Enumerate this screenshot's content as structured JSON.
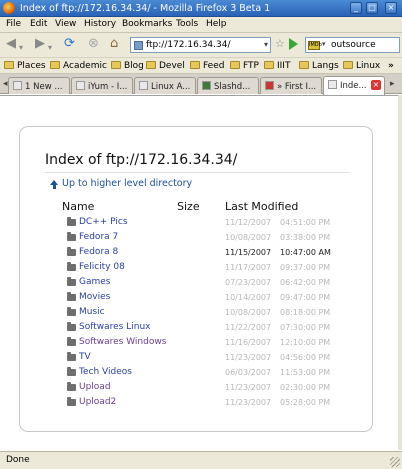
{
  "window": {
    "title": "Index of ftp://172.16.34.34/ - Mozilla Firefox 3 Beta 1"
  },
  "menu": [
    "File",
    "Edit",
    "View",
    "History",
    "Bookmarks",
    "Tools",
    "Help"
  ],
  "nav": {
    "url": "ftp://172.16.34.34/",
    "search_text": "outsource"
  },
  "bookmarks": [
    "Places",
    "Academic",
    "Blog",
    "Devel",
    "Feed",
    "FTP",
    "IIIT",
    "Langs",
    "Linux",
    "»"
  ],
  "tabs": [
    {
      "label": "1 New ...",
      "active": false
    },
    {
      "label": "iYum - I...",
      "active": false
    },
    {
      "label": "Linux A...",
      "active": false
    },
    {
      "label": "Slashd...",
      "active": false
    },
    {
      "label": "» First I...",
      "active": false
    },
    {
      "label": "Inde...",
      "active": true
    }
  ],
  "page": {
    "heading": "Index of ftp://172.16.34.34/",
    "up_link": "Up to higher level directory",
    "columns": {
      "name": "Name",
      "size": "Size",
      "modified": "Last Modified"
    },
    "entries": [
      {
        "name": "DC++ Pics",
        "date": "11/12/2007",
        "time": "04:51:00 PM",
        "visited": false,
        "highlight": false
      },
      {
        "name": "Fedora 7",
        "date": "10/08/2007",
        "time": "03:38:00 PM",
        "visited": false,
        "highlight": false
      },
      {
        "name": "Fedora 8",
        "date": "11/15/2007",
        "time": "10:47:00 AM",
        "visited": false,
        "highlight": true
      },
      {
        "name": "Felicity 08",
        "date": "11/17/2007",
        "time": "09:37:00 PM",
        "visited": false,
        "highlight": false
      },
      {
        "name": "Games",
        "date": "07/23/2007",
        "time": "06:42:00 PM",
        "visited": false,
        "highlight": false
      },
      {
        "name": "Movies",
        "date": "10/14/2007",
        "time": "09:47:00 PM",
        "visited": false,
        "highlight": false
      },
      {
        "name": "Music",
        "date": "10/08/2007",
        "time": "08:18:00 PM",
        "visited": false,
        "highlight": false
      },
      {
        "name": "Softwares Linux",
        "date": "11/22/2007",
        "time": "07:30:00 PM",
        "visited": false,
        "highlight": false
      },
      {
        "name": "Softwares Windows",
        "date": "11/16/2007",
        "time": "12:10:00 PM",
        "visited": true,
        "highlight": false
      },
      {
        "name": "TV",
        "date": "11/23/2007",
        "time": "04:56:00 PM",
        "visited": false,
        "highlight": false
      },
      {
        "name": "Tech Videos",
        "date": "06/03/2007",
        "time": "11:53:00 PM",
        "visited": false,
        "highlight": false
      },
      {
        "name": "Upload",
        "date": "11/23/2007",
        "time": "02:30:00 PM",
        "visited": true,
        "highlight": false
      },
      {
        "name": "Upload2",
        "date": "11/23/2007",
        "time": "05:28:00 PM",
        "visited": true,
        "highlight": false
      }
    ]
  },
  "status": {
    "text": "Done"
  }
}
